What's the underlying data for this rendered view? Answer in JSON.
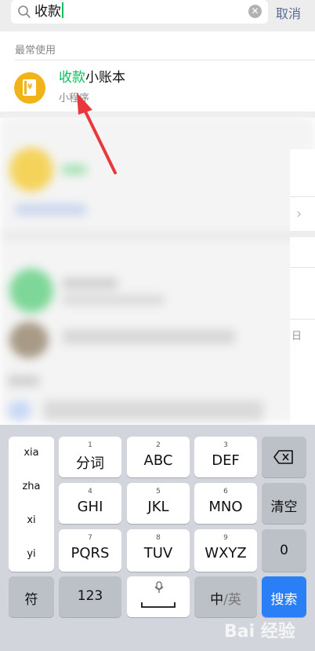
{
  "search": {
    "query": "收款",
    "cancel_label": "取消"
  },
  "recent": {
    "section_title": "最常使用",
    "result": {
      "title_highlight": "收款",
      "title_rest": "小账本",
      "subtitle": "小程序"
    }
  },
  "features": {
    "section_title": "功能",
    "side_char": "日"
  },
  "keyboard": {
    "side_list": [
      "xia",
      "zha",
      "xi",
      "yi"
    ],
    "keys": [
      {
        "num": "1",
        "label": "分词"
      },
      {
        "num": "2",
        "label": "ABC"
      },
      {
        "num": "3",
        "label": "DEF"
      },
      {
        "num": "4",
        "label": "GHI"
      },
      {
        "num": "5",
        "label": "JKL"
      },
      {
        "num": "6",
        "label": "MNO"
      },
      {
        "num": "7",
        "label": "PQRS"
      },
      {
        "num": "8",
        "label": "TUV"
      },
      {
        "num": "9",
        "label": "WXYZ"
      }
    ],
    "clear_label": "清空",
    "zero_label": "0",
    "symbol_label": "符",
    "num_label": "123",
    "lang_zh": "中",
    "lang_en": "/英",
    "search_label": "搜索"
  },
  "watermark": "Bai 经验",
  "colors": {
    "highlight": "#07c160",
    "link": "#576b95",
    "icon_bg": "#f2b318",
    "search_key": "#2b7ff6",
    "arrow": "#e8383d"
  }
}
